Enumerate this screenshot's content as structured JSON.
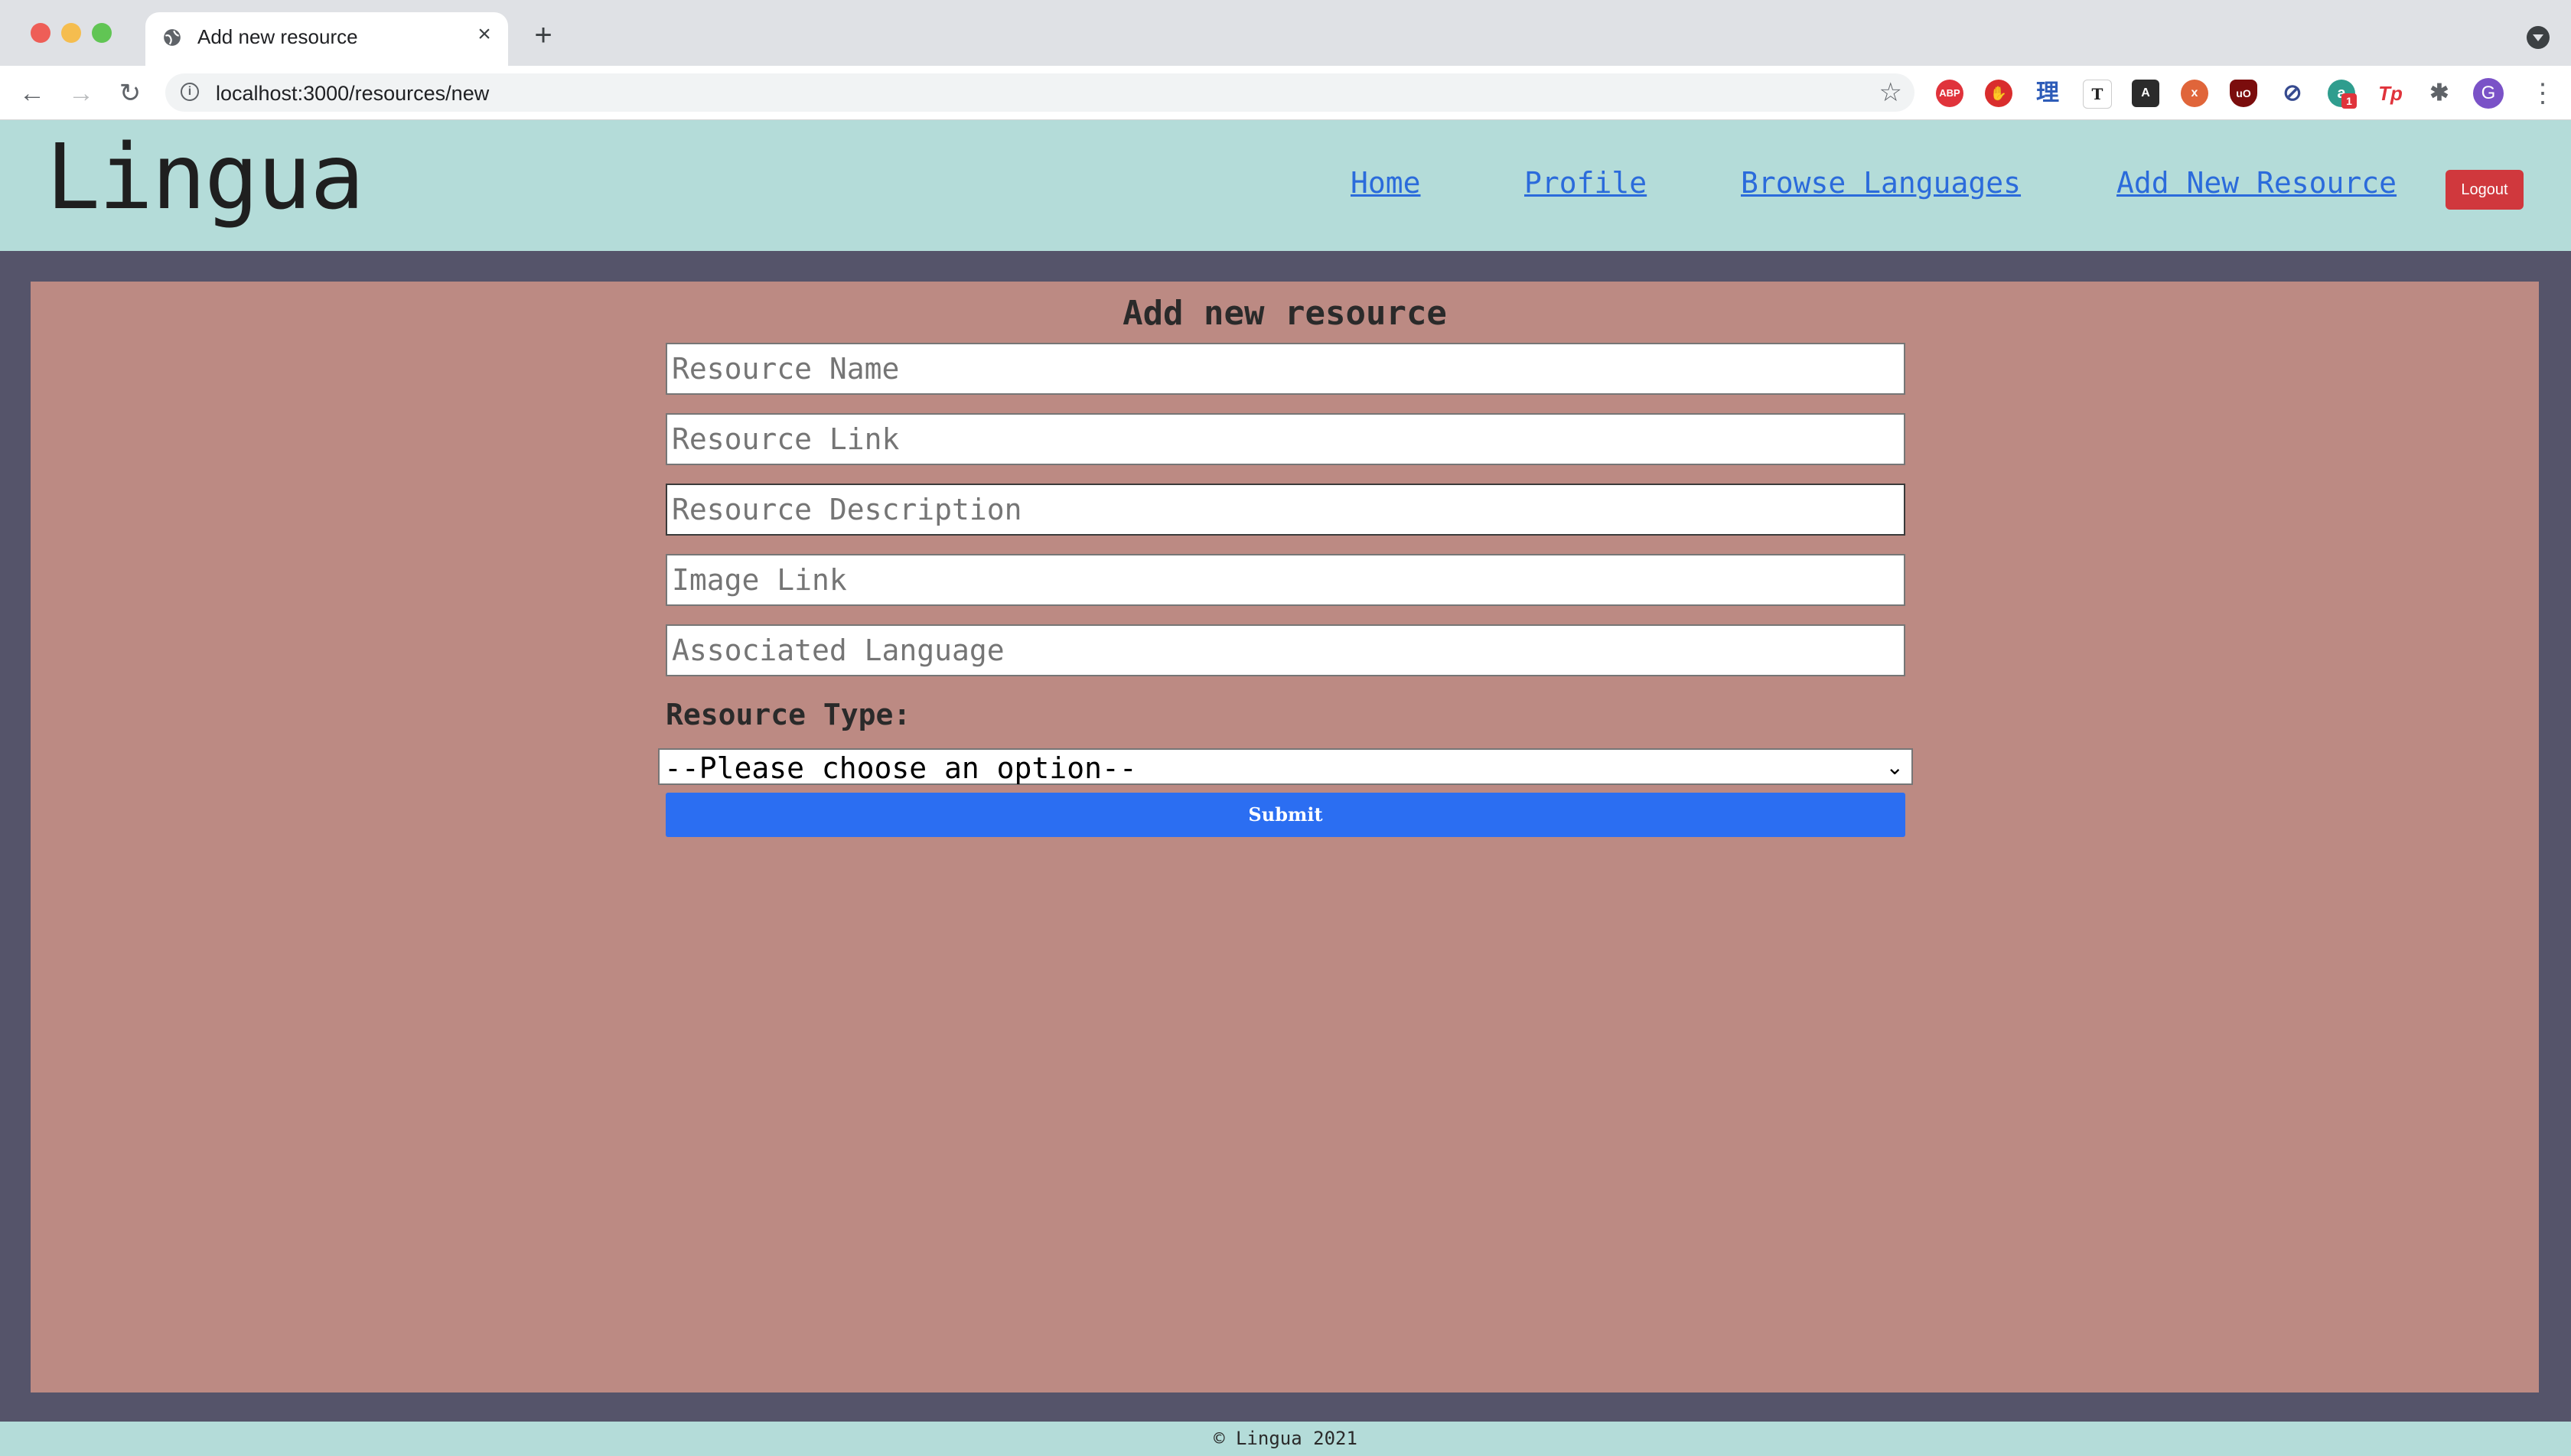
{
  "browser": {
    "tab_title": "Add new resource",
    "url": "localhost:3000/resources/new",
    "avatar_initial": "G",
    "extensions": [
      "ABP",
      "stop",
      "理",
      "T",
      "A",
      "x",
      "uO",
      "⊘",
      "a",
      "Tp",
      "puzzle"
    ],
    "extension_badge": "1"
  },
  "site": {
    "logo": "Lingua",
    "nav": {
      "home": "Home",
      "profile": "Profile",
      "browse": "Browse Languages",
      "add": "Add New Resource"
    },
    "logout_label": "Logout"
  },
  "form": {
    "title": "Add new resource",
    "fields": {
      "name": "Resource Name",
      "link": "Resource Link",
      "description": "Resource Description",
      "image": "Image Link",
      "language": "Associated Language"
    },
    "type_label": "Resource Type:",
    "type_selected": "--Please choose an option--",
    "submit_label": "Submit"
  },
  "footer": {
    "text": "© Lingua 2021"
  },
  "colors": {
    "header_bg": "#b4dcd9",
    "panel_bg": "#bc8a83",
    "page_bg": "#55546a",
    "link": "#2b6bdb",
    "logout": "#d0383d",
    "submit": "#2b6ef2"
  }
}
